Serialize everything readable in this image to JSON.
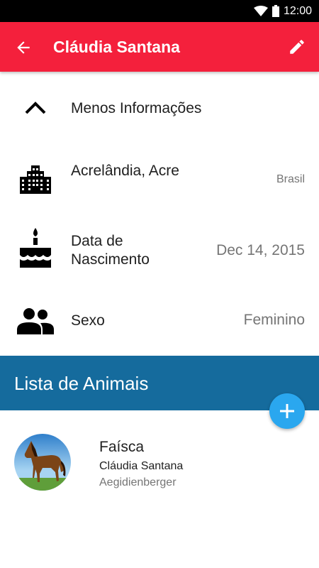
{
  "status_bar": {
    "time": "12:00"
  },
  "app_bar": {
    "title": "Cláudia Santana"
  },
  "rows": {
    "toggle": {
      "label": "Menos Informações"
    },
    "location": {
      "label": "Acrelândia, Acre",
      "value": "Brasil"
    },
    "birth": {
      "label_line1": "Data de",
      "label_line2": "Nascimento",
      "value": "Dec 14, 2015"
    },
    "gender": {
      "label": "Sexo",
      "value": "Feminino"
    }
  },
  "animals_section": {
    "title": "Lista de Animais"
  },
  "animals": [
    {
      "name": "Faísca",
      "owner": "Cláudia Santana",
      "breed": "Aegidienberger"
    }
  ],
  "colors": {
    "app_bar": "#f4203c",
    "section_header": "#156b9d",
    "fab": "#2aa7ef"
  }
}
